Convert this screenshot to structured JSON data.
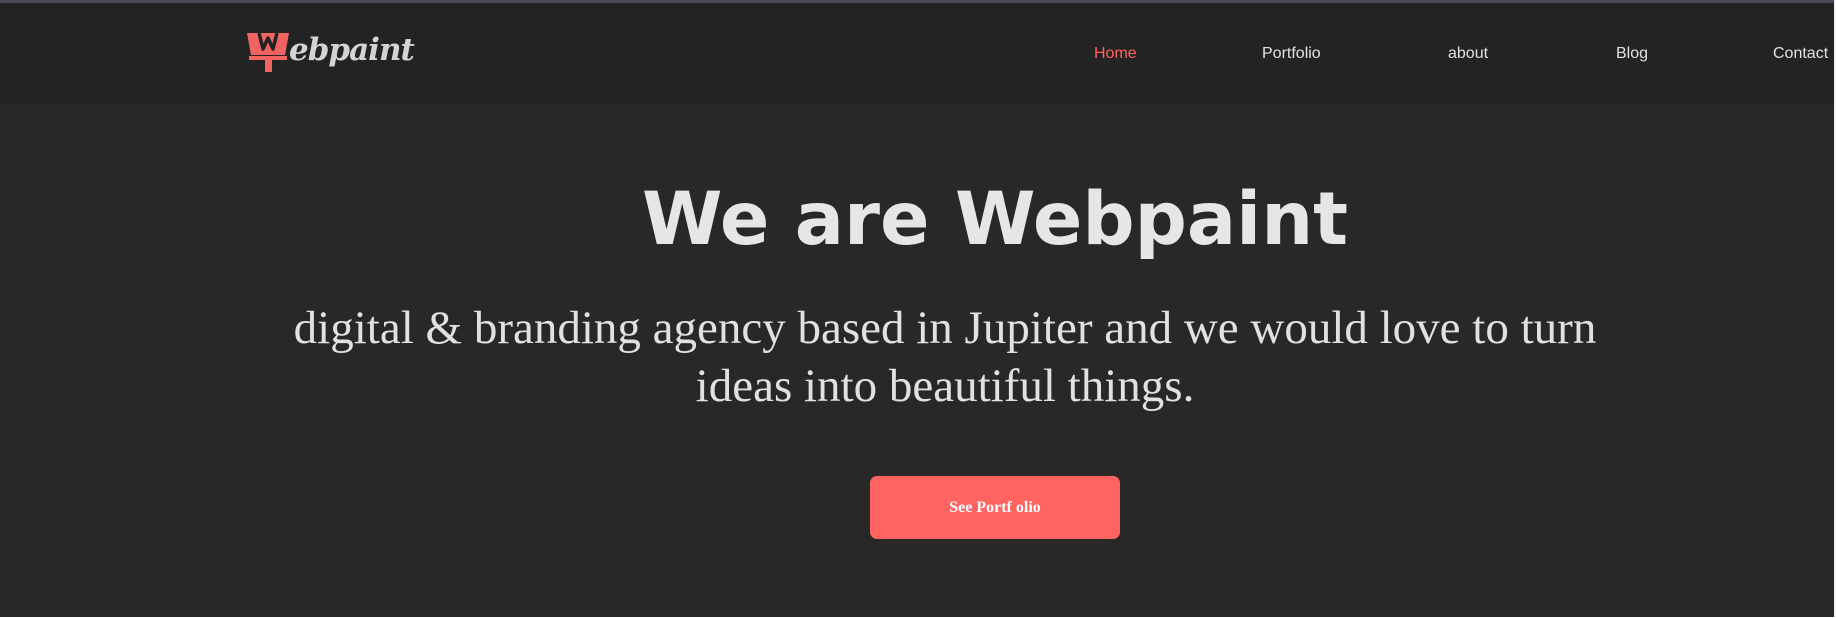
{
  "brand": {
    "name": "Webpaint",
    "logo_text": "ebpaint",
    "accent_color": "#ff6461"
  },
  "nav": {
    "items": [
      {
        "label": "Home",
        "active": true
      },
      {
        "label": "Portfolio",
        "active": false
      },
      {
        "label": "about",
        "active": false
      },
      {
        "label": "Blog",
        "active": false
      },
      {
        "label": "Contact",
        "active": false
      }
    ]
  },
  "hero": {
    "title": "We are Webpaint",
    "subtitle": "digital & branding agency based in Jupiter and we would love to turn ideas into beautiful things.",
    "cta_label": "See Portf olio"
  },
  "icons": {
    "logo": "paintbrush-w-logo-icon"
  }
}
